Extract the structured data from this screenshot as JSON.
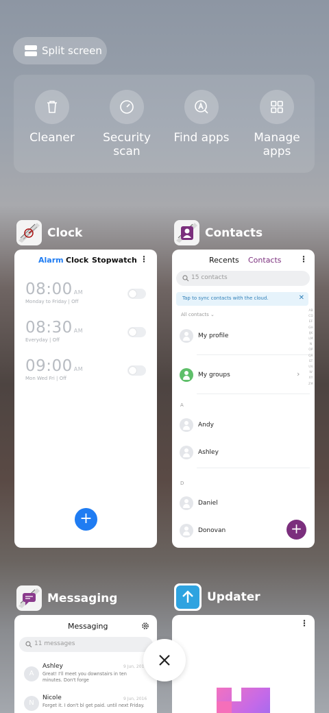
{
  "split_screen": {
    "label": "Split screen",
    "icon": "split-screen-icon"
  },
  "tools": [
    {
      "label": "Cleaner",
      "icon": "trash-icon"
    },
    {
      "label": "Security\nscan",
      "line1": "Security",
      "line2": "scan",
      "icon": "security-scan-icon"
    },
    {
      "label": "Find apps",
      "icon": "find-apps-icon"
    },
    {
      "label": "Manage apps",
      "line1": "Manage",
      "line2": "apps",
      "icon": "manage-apps-icon"
    }
  ],
  "clock": {
    "title": "Clock",
    "tabs": {
      "alarm": "Alarm",
      "clock": "Clock",
      "stopwatch": "Stopwatch"
    },
    "alarms": [
      {
        "time": "08:00",
        "ampm": "AM",
        "days": "Monday to Friday",
        "state": "Off"
      },
      {
        "time": "08:30",
        "ampm": "AM",
        "days": "Everyday",
        "state": "Off"
      },
      {
        "time": "09:00",
        "ampm": "AM",
        "days": "Mon Wed Fri",
        "state": "Off"
      }
    ],
    "fab": "+",
    "accent": "#1f7cf2"
  },
  "contacts": {
    "title": "Contacts",
    "tabs": {
      "recents": "Recents",
      "contacts": "Contacts"
    },
    "search_placeholder": "15 contacts",
    "sync_banner": "Tap to sync contacts with the cloud.",
    "filter": "All contacts",
    "my_profile": "My profile",
    "my_groups": "My groups",
    "sections": [
      {
        "letter": "A",
        "names": [
          "Andy",
          "Ashley"
        ]
      },
      {
        "letter": "D",
        "names": [
          "Daniel",
          "Donovan"
        ]
      }
    ],
    "alphabet": "ABCDEFGHIJKLMNOPQRSTUVWXYZ#",
    "fab": "+",
    "accent": "#7b2f7d"
  },
  "messaging": {
    "title": "Messaging",
    "header": "Messaging",
    "search_placeholder": "11 messages",
    "threads": [
      {
        "initial": "A",
        "name": "Ashley",
        "date": "9 Jun, 2016",
        "preview": "Great! I'll meet you downstairs in ten minutes. Don't forge"
      },
      {
        "initial": "N",
        "name": "Nicole",
        "date": "9 Jun, 2016",
        "preview": "Forget it. I don't bl get paid. until next Friday."
      }
    ]
  },
  "updater": {
    "title": "Updater"
  },
  "close": {
    "icon": "close-icon"
  }
}
